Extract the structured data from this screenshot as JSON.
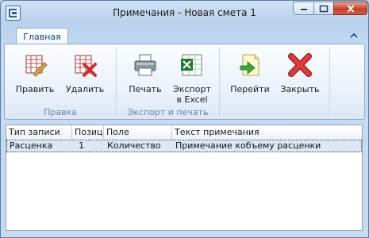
{
  "window": {
    "title": "Примечания - Новая смета 1"
  },
  "ribbon": {
    "tab_home": "Главная",
    "groups": {
      "edit": {
        "label": "Правка",
        "edit_button": "Править",
        "delete_button": "Удалить"
      },
      "export": {
        "label": "Экспорт и печать",
        "print_button": "Печать",
        "export_excel_line1": "Экспорт",
        "export_excel_line2": "в Excel"
      },
      "nav": {
        "goto_button": "Перейти",
        "close_button": "Закрыть"
      }
    }
  },
  "table": {
    "columns": [
      "Тип записи",
      "Позиция",
      "Поле",
      "Текст примечания"
    ],
    "rows": [
      [
        "Расценка",
        "1",
        "Количество",
        "Примечание кобъему расценки"
      ]
    ]
  },
  "colors": {
    "accent": "#15428b",
    "selection": "#dce8f5",
    "close_button": "#c7402a"
  }
}
